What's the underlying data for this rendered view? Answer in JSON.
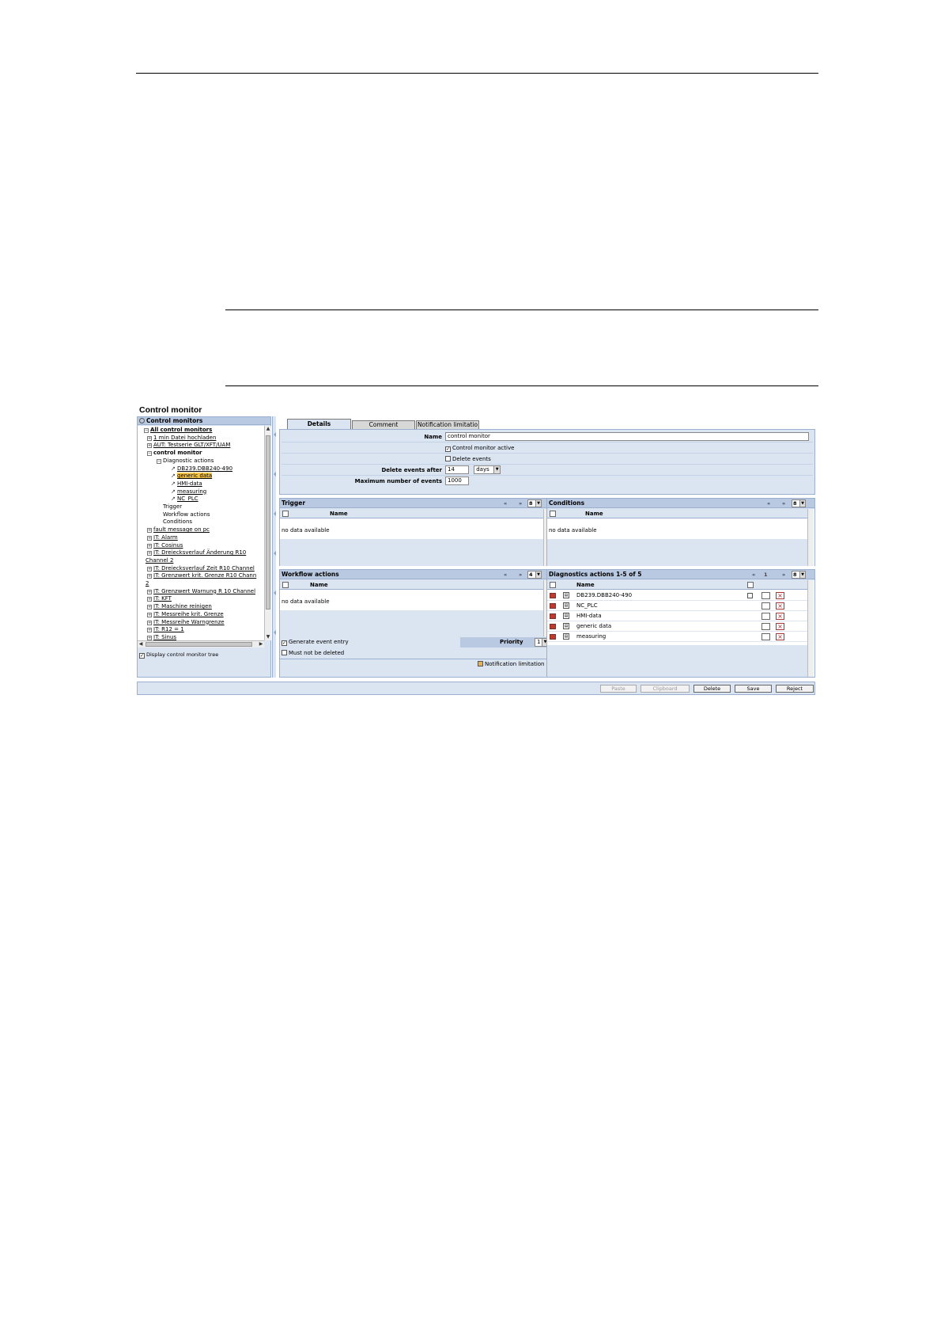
{
  "figure": {
    "title": "Control monitor"
  },
  "tree": {
    "header": "Control monitors",
    "nodes": [
      {
        "label": "All control monitors",
        "style": "bold-link",
        "exp": "−"
      },
      {
        "label": "1 min Datei hochladen",
        "style": "link",
        "exp": "+"
      },
      {
        "label": "AUT: Testserie GLT/XFT/UAM",
        "style": "link",
        "exp": "+"
      },
      {
        "label": "control monitor",
        "style": "bold",
        "exp": "−"
      },
      {
        "label": "Diagnostic actions",
        "style": "plain",
        "exp": "−"
      },
      {
        "label": "DB239.DBB240-490",
        "style": "link",
        "exp": ""
      },
      {
        "label": "generic data",
        "style": "link-selected",
        "exp": ""
      },
      {
        "label": "HMI-data",
        "style": "link",
        "exp": ""
      },
      {
        "label": "measuring",
        "style": "link",
        "exp": ""
      },
      {
        "label": "NC_PLC",
        "style": "link",
        "exp": ""
      },
      {
        "label": "Trigger",
        "style": "plain",
        "exp": ""
      },
      {
        "label": "Workflow actions",
        "style": "plain",
        "exp": ""
      },
      {
        "label": "Conditions",
        "style": "plain",
        "exp": ""
      },
      {
        "label": "fault message on pc",
        "style": "link",
        "exp": "+"
      },
      {
        "label": "IT: Alarm",
        "style": "link",
        "exp": "+"
      },
      {
        "label": "IT: Cosinus",
        "style": "link",
        "exp": "+"
      },
      {
        "label": "IT: Dreiecksverlauf Änderung R10",
        "style": "link",
        "exp": "+"
      },
      {
        "label": "Channel 2",
        "style": "link",
        "exp": ""
      },
      {
        "label": "IT: Dreiecksverlauf Zeit R10 Channel",
        "style": "link",
        "exp": "+"
      },
      {
        "label": "IT: Grenzwert krit. Grenze R10 Chann",
        "style": "link",
        "exp": "+"
      },
      {
        "label": "2",
        "style": "link",
        "exp": ""
      },
      {
        "label": "IT: Grenzwert Warnung R 10 Channel",
        "style": "link",
        "exp": "+"
      },
      {
        "label": "IT: KFT",
        "style": "link",
        "exp": "+"
      },
      {
        "label": "IT: Maschine reinigen",
        "style": "link",
        "exp": "+"
      },
      {
        "label": "IT: Messreihe krit. Grenze",
        "style": "link",
        "exp": "+"
      },
      {
        "label": "IT: Messreihe Warngrenze",
        "style": "link",
        "exp": "+"
      },
      {
        "label": "IT: R12 = 1",
        "style": "link",
        "exp": "+"
      },
      {
        "label": "IT: Sinus",
        "style": "link",
        "exp": "+"
      }
    ],
    "display_tree_label": "Display control monitor tree",
    "display_tree_checked": true
  },
  "tabs": [
    "Details",
    "Comment",
    "Notification limitatio"
  ],
  "details": {
    "name_label": "Name",
    "name_value": "control monitor",
    "active_label": "Control monitor active",
    "active_checked": true,
    "delete_events_label": "Delete events",
    "delete_events_checked": false,
    "delete_after_label": "Delete events after",
    "delete_after_value": "14",
    "delete_after_unit": "days",
    "max_events_label": "Maximum number of events",
    "max_events_value": "1000"
  },
  "trigger": {
    "title": "Trigger",
    "col_name": "Name",
    "empty": "no data available",
    "count": "8"
  },
  "conditions": {
    "title": "Conditions",
    "col_name": "Name",
    "empty": "no data available",
    "count": "8"
  },
  "workflow": {
    "title": "Workflow actions",
    "col_name": "Name",
    "empty": "no data available",
    "count": "4",
    "generate_label": "Generate event entry",
    "generate_checked": true,
    "priority_label": "Priority",
    "priority_value": "1",
    "must_not_delete_label": "Must not be deleted",
    "must_not_delete_checked": false,
    "notification_label": "Notification limitation"
  },
  "diagnostics": {
    "title": "Diagnostics actions 1-5 of 5",
    "col_name": "Name",
    "page": "1",
    "count": "8",
    "rows": [
      "DB239.DBB240-490",
      "NC_PLC",
      "HMI-data",
      "generic data",
      "measuring"
    ]
  },
  "buttons": {
    "paste": "Paste",
    "clipboard": "Clipboard",
    "delete": "Delete",
    "save": "Save",
    "reject": "Reject"
  },
  "nav": {
    "prev": "«",
    "next": "»"
  }
}
